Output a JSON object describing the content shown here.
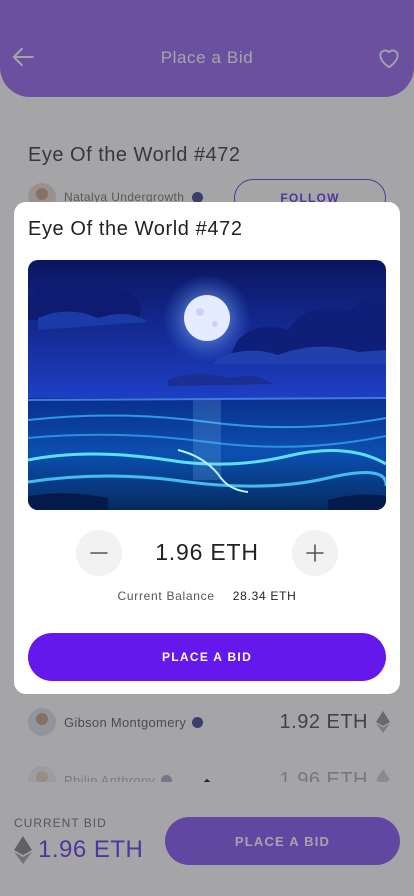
{
  "header": {
    "title": "Place a Bid",
    "back_icon": "arrow-left-icon",
    "favorite_icon": "heart-icon"
  },
  "background": {
    "nft_title": "Eye Of the World #472",
    "owner_name": "Natalya Undergrowth",
    "follow_label": "FOLLOW",
    "bids": [
      {
        "name": "Gibson Montgomery",
        "amount": "1.92 ETH"
      },
      {
        "name": "Philip Anthropy",
        "amount": "1.96 ETH"
      }
    ]
  },
  "footer": {
    "current_bid_label": "CURRENT BID",
    "current_bid_value": "1.96 ETH",
    "place_bid_label": "PLACE A BID"
  },
  "modal": {
    "title": "Eye Of the World #472",
    "artwork": "moonlit-ocean-night-illustration",
    "bid_amount": "1.96 ETH",
    "balance_label": "Current Balance",
    "balance_value": "28.34 ETH",
    "place_bid_label": "PLACE A BID"
  },
  "colors": {
    "header": "#9a6df0",
    "accent": "#6418ec",
    "footer_button": "#8a5cf5"
  }
}
